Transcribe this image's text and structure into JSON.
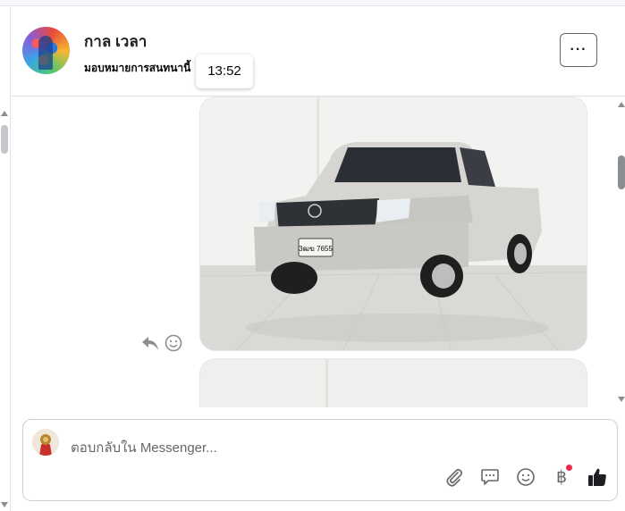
{
  "header": {
    "contact_name": "กาล เวลา",
    "subtitle": "มอบหมายการสนทนานี้",
    "tooltip_time": "13:52",
    "more_label": "···"
  },
  "conversation": {
    "photo1": {
      "plate_text": "3ฒฆ 7655"
    }
  },
  "composer": {
    "placeholder": "ตอบกลับใน Messenger...",
    "baht_symbol": "฿"
  },
  "icons": {
    "reply": "reply-icon",
    "react": "smiley-icon",
    "attach": "paperclip-icon",
    "saved_replies": "chat-bubble-icon",
    "emoji": "emoji-icon",
    "payment": "baht-icon",
    "like": "thumbs-up-icon",
    "more": "more-dots-icon"
  },
  "colors": {
    "accent": "#1c1e21",
    "notification_dot": "#f02849",
    "muted": "#65676b"
  }
}
